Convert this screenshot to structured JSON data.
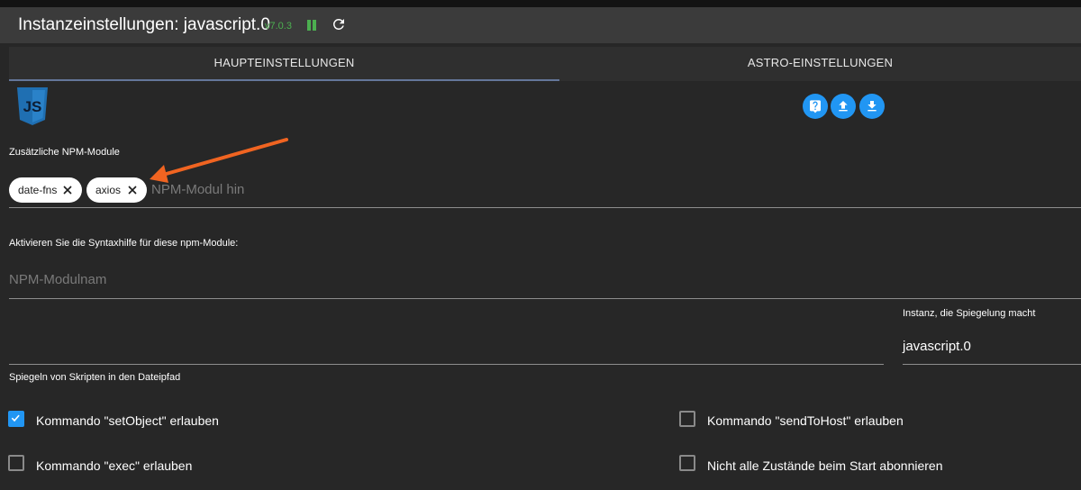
{
  "header": {
    "title": "Instanzeinstellungen: javascript.0",
    "version": "v7.0.3",
    "pause_icon": "pause-icon",
    "reload_icon": "reload-icon"
  },
  "tabs": [
    {
      "label": "HAUPTEINSTELLUNGEN",
      "active": true
    },
    {
      "label": "ASTRO-EINSTELLUNGEN",
      "active": false
    }
  ],
  "logo": {
    "text": "JS"
  },
  "actions": [
    {
      "icon": "help-icon"
    },
    {
      "icon": "upload-icon"
    },
    {
      "icon": "download-icon"
    }
  ],
  "npm": {
    "label": "Zusätzliche NPM-Module",
    "chips": [
      "date-fns",
      "axios"
    ],
    "placeholder": "NPM-Modul hin"
  },
  "syntax": {
    "label": "Aktivieren Sie die Syntaxhilfe für diese npm-Module:",
    "placeholder": "NPM-Modulnam"
  },
  "mirror": {
    "path_label": "Spiegeln von Skripten in den Dateipfad",
    "path_value": "",
    "instance_label": "Instanz, die Spiegelung macht",
    "instance_value": "javascript.0"
  },
  "checkboxes": [
    {
      "label": "Kommando \"setObject\" erlauben",
      "checked": true
    },
    {
      "label": "Kommando \"sendToHost\" erlauben",
      "checked": false
    },
    {
      "label": "Kommando \"exec\" erlauben",
      "checked": false
    },
    {
      "label": "Nicht alle Zustände beim Start abonnieren",
      "checked": false
    }
  ],
  "colors": {
    "accent": "#2196f3",
    "running": "#4caf50",
    "annotation_arrow": "#f06421"
  }
}
